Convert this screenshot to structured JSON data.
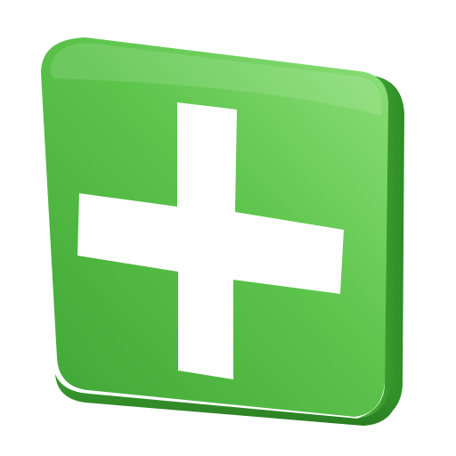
{
  "icon": {
    "name": "add-plus-icon",
    "colors": {
      "face_light": "#8FE07A",
      "face_mid": "#5CC44B",
      "face_dark": "#3FA535",
      "side": "#2E8C26",
      "plus": "#FFFFFF"
    }
  }
}
